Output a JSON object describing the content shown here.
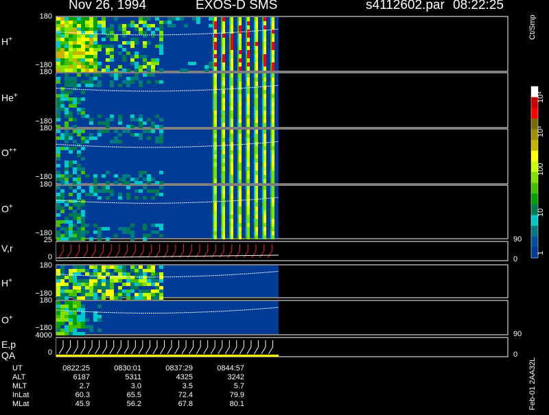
{
  "header": {
    "date": "Nov 26, 1994",
    "instrument": "EXOS-D SMS",
    "file": "s4112602.par",
    "time": "08:22:25"
  },
  "panels": [
    {
      "id": "h_plus_1",
      "species": "H",
      "charge": "+",
      "y_top": "180",
      "y_bottom": "−180"
    },
    {
      "id": "he_plus",
      "species": "He",
      "charge": "+",
      "y_top": "180",
      "y_bottom": "−180"
    },
    {
      "id": "o_plus_plus",
      "species": "O",
      "charge": "++",
      "y_top": "180",
      "y_bottom": "−180"
    },
    {
      "id": "o_plus_1",
      "species": "O",
      "charge": "+",
      "y_top": "180",
      "y_bottom": "−180"
    },
    {
      "id": "vr",
      "label": "V,r",
      "y_top": "25",
      "y_bottom": "0",
      "r_top": "90",
      "r_bottom": "0"
    },
    {
      "id": "h_plus_2",
      "species": "H",
      "charge": "+",
      "y_top": "180",
      "y_bottom": "−180"
    },
    {
      "id": "o_plus_2",
      "species": "O",
      "charge": "+",
      "y_top": "180",
      "y_bottom": "−180"
    },
    {
      "id": "ep_qa",
      "label1": "E,p",
      "label2": "QA",
      "y_top": "4000",
      "y_bottom": "0",
      "r_top": "90",
      "r_bottom": "0"
    }
  ],
  "colorbar": {
    "unit": "Ct/Smp",
    "labels": [
      "10⁴",
      "10³",
      "100",
      "10",
      "1"
    ],
    "colors": [
      "#ffffff",
      "#c80000",
      "#ff0000",
      "#7a6a00",
      "#a09000",
      "#c8b400",
      "#ffff00",
      "#c8ff00",
      "#80e000",
      "#40c000",
      "#00a000",
      "#007a50",
      "#00c8c8",
      "#007a80",
      "#0050a0",
      "#003c96"
    ]
  },
  "orbit_table": {
    "rows": [
      {
        "label": "UT",
        "values": [
          "0822:25",
          "0830:01",
          "0837:29",
          "0844:57"
        ]
      },
      {
        "label": "ALT",
        "values": [
          "6187",
          "5311",
          "4325",
          "3242"
        ]
      },
      {
        "label": "MLT",
        "values": [
          "2.7",
          "3.0",
          "3.5",
          "5.7"
        ]
      },
      {
        "label": "InLat",
        "values": [
          "60.3",
          "65.5",
          "72.4",
          "79.9"
        ]
      },
      {
        "label": "MLat",
        "values": [
          "45.9",
          "56.2",
          "67.8",
          "80.1"
        ]
      }
    ]
  },
  "footer_id": "Feb-01 2AA32L",
  "chart_data": {
    "type": "heatmap",
    "title": "Nov 26, 1994   EXOS-D SMS",
    "xlabel": "UT",
    "x": [
      "0822:25",
      "0830:01",
      "0837:29",
      "0844:57"
    ],
    "series": [
      {
        "name": "H+",
        "ylim": [
          -180,
          180
        ]
      },
      {
        "name": "He+",
        "ylim": [
          -180,
          180
        ]
      },
      {
        "name": "O++",
        "ylim": [
          -180,
          180
        ]
      },
      {
        "name": "O+",
        "ylim": [
          -180,
          180
        ]
      },
      {
        "name": "V,r",
        "ylim": [
          0,
          25
        ]
      },
      {
        "name": "H+",
        "ylim": [
          -180,
          180
        ]
      },
      {
        "name": "O+",
        "ylim": [
          -180,
          180
        ]
      },
      {
        "name": "E,p",
        "ylim": [
          0,
          4000
        ]
      }
    ],
    "colorscale_unit": "Ct/Smp",
    "colorscale_ticks": [
      "1",
      "10",
      "100",
      "10³",
      "10⁴"
    ]
  }
}
